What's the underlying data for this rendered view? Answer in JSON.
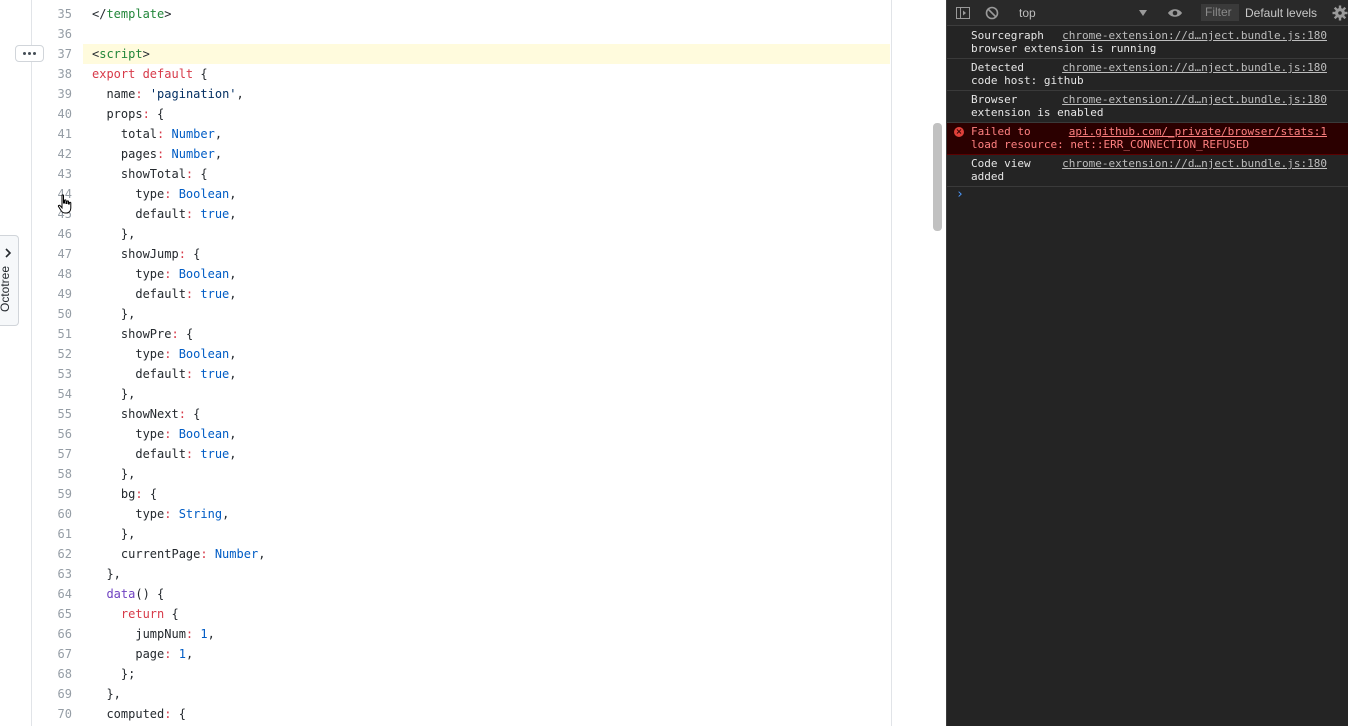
{
  "code_view": {
    "more_button_label": "…",
    "octotree_label": "Octotree",
    "lines": [
      {
        "num": "35",
        "tokens": [
          {
            "t": "</",
            "c": "t-p"
          },
          {
            "t": "template",
            "c": "t-tag"
          },
          {
            "t": ">",
            "c": "t-p"
          }
        ]
      },
      {
        "num": "36",
        "tokens": []
      },
      {
        "num": "37",
        "tokens": [
          {
            "t": "<",
            "c": "t-p"
          },
          {
            "t": "script",
            "c": "t-tag"
          },
          {
            "t": ">",
            "c": "t-p"
          }
        ]
      },
      {
        "num": "38",
        "tokens": [
          {
            "t": "export default",
            "c": "t-kw"
          },
          {
            "t": " {",
            "c": "t-p"
          }
        ]
      },
      {
        "num": "39",
        "tokens": [
          {
            "t": "  name",
            "c": "t-p"
          },
          {
            "t": ":",
            "c": "t-kw"
          },
          {
            "t": " 'pagination'",
            "c": "t-s"
          },
          {
            "t": ",",
            "c": "t-p"
          }
        ]
      },
      {
        "num": "40",
        "tokens": [
          {
            "t": "  props",
            "c": "t-p"
          },
          {
            "t": ":",
            "c": "t-kw"
          },
          {
            "t": " {",
            "c": "t-p"
          }
        ]
      },
      {
        "num": "41",
        "tokens": [
          {
            "t": "    total",
            "c": "t-p"
          },
          {
            "t": ":",
            "c": "t-kw"
          },
          {
            "t": " Number",
            "c": "t-c"
          },
          {
            "t": ",",
            "c": "t-p"
          }
        ]
      },
      {
        "num": "42",
        "tokens": [
          {
            "t": "    pages",
            "c": "t-p"
          },
          {
            "t": ":",
            "c": "t-kw"
          },
          {
            "t": " Number",
            "c": "t-c"
          },
          {
            "t": ",",
            "c": "t-p"
          }
        ]
      },
      {
        "num": "43",
        "tokens": [
          {
            "t": "    showTotal",
            "c": "t-p"
          },
          {
            "t": ":",
            "c": "t-kw"
          },
          {
            "t": " {",
            "c": "t-p"
          }
        ]
      },
      {
        "num": "44",
        "tokens": [
          {
            "t": "      type",
            "c": "t-p"
          },
          {
            "t": ":",
            "c": "t-kw"
          },
          {
            "t": " Boolean",
            "c": "t-c"
          },
          {
            "t": ",",
            "c": "t-p"
          }
        ]
      },
      {
        "num": "45",
        "tokens": [
          {
            "t": "      default",
            "c": "t-p"
          },
          {
            "t": ":",
            "c": "t-kw"
          },
          {
            "t": " true",
            "c": "t-c"
          },
          {
            "t": ",",
            "c": "t-p"
          }
        ]
      },
      {
        "num": "46",
        "tokens": [
          {
            "t": "    },",
            "c": "t-p"
          }
        ]
      },
      {
        "num": "47",
        "tokens": [
          {
            "t": "    showJump",
            "c": "t-p"
          },
          {
            "t": ":",
            "c": "t-kw"
          },
          {
            "t": " {",
            "c": "t-p"
          }
        ]
      },
      {
        "num": "48",
        "tokens": [
          {
            "t": "      type",
            "c": "t-p"
          },
          {
            "t": ":",
            "c": "t-kw"
          },
          {
            "t": " Boolean",
            "c": "t-c"
          },
          {
            "t": ",",
            "c": "t-p"
          }
        ]
      },
      {
        "num": "49",
        "tokens": [
          {
            "t": "      default",
            "c": "t-p"
          },
          {
            "t": ":",
            "c": "t-kw"
          },
          {
            "t": " true",
            "c": "t-c"
          },
          {
            "t": ",",
            "c": "t-p"
          }
        ]
      },
      {
        "num": "50",
        "tokens": [
          {
            "t": "    },",
            "c": "t-p"
          }
        ]
      },
      {
        "num": "51",
        "tokens": [
          {
            "t": "    showPre",
            "c": "t-p"
          },
          {
            "t": ":",
            "c": "t-kw"
          },
          {
            "t": " {",
            "c": "t-p"
          }
        ]
      },
      {
        "num": "52",
        "tokens": [
          {
            "t": "      type",
            "c": "t-p"
          },
          {
            "t": ":",
            "c": "t-kw"
          },
          {
            "t": " Boolean",
            "c": "t-c"
          },
          {
            "t": ",",
            "c": "t-p"
          }
        ]
      },
      {
        "num": "53",
        "tokens": [
          {
            "t": "      default",
            "c": "t-p"
          },
          {
            "t": ":",
            "c": "t-kw"
          },
          {
            "t": " true",
            "c": "t-c"
          },
          {
            "t": ",",
            "c": "t-p"
          }
        ]
      },
      {
        "num": "54",
        "tokens": [
          {
            "t": "    },",
            "c": "t-p"
          }
        ]
      },
      {
        "num": "55",
        "tokens": [
          {
            "t": "    showNext",
            "c": "t-p"
          },
          {
            "t": ":",
            "c": "t-kw"
          },
          {
            "t": " {",
            "c": "t-p"
          }
        ]
      },
      {
        "num": "56",
        "tokens": [
          {
            "t": "      type",
            "c": "t-p"
          },
          {
            "t": ":",
            "c": "t-kw"
          },
          {
            "t": " Boolean",
            "c": "t-c"
          },
          {
            "t": ",",
            "c": "t-p"
          }
        ]
      },
      {
        "num": "57",
        "tokens": [
          {
            "t": "      default",
            "c": "t-p"
          },
          {
            "t": ":",
            "c": "t-kw"
          },
          {
            "t": " true",
            "c": "t-c"
          },
          {
            "t": ",",
            "c": "t-p"
          }
        ]
      },
      {
        "num": "58",
        "tokens": [
          {
            "t": "    },",
            "c": "t-p"
          }
        ]
      },
      {
        "num": "59",
        "tokens": [
          {
            "t": "    bg",
            "c": "t-p"
          },
          {
            "t": ":",
            "c": "t-kw"
          },
          {
            "t": " {",
            "c": "t-p"
          }
        ]
      },
      {
        "num": "60",
        "tokens": [
          {
            "t": "      type",
            "c": "t-p"
          },
          {
            "t": ":",
            "c": "t-kw"
          },
          {
            "t": " String",
            "c": "t-c"
          },
          {
            "t": ",",
            "c": "t-p"
          }
        ]
      },
      {
        "num": "61",
        "tokens": [
          {
            "t": "    },",
            "c": "t-p"
          }
        ]
      },
      {
        "num": "62",
        "tokens": [
          {
            "t": "    currentPage",
            "c": "t-p"
          },
          {
            "t": ":",
            "c": "t-kw"
          },
          {
            "t": " Number",
            "c": "t-c"
          },
          {
            "t": ",",
            "c": "t-p"
          }
        ]
      },
      {
        "num": "63",
        "tokens": [
          {
            "t": "  },",
            "c": "t-p"
          }
        ]
      },
      {
        "num": "64",
        "tokens": [
          {
            "t": "  ",
            "c": "t-p"
          },
          {
            "t": "data",
            "c": "t-fn"
          },
          {
            "t": "() {",
            "c": "t-p"
          }
        ]
      },
      {
        "num": "65",
        "tokens": [
          {
            "t": "    ",
            "c": "t-p"
          },
          {
            "t": "return",
            "c": "t-kw"
          },
          {
            "t": " {",
            "c": "t-p"
          }
        ]
      },
      {
        "num": "66",
        "tokens": [
          {
            "t": "      jumpNum",
            "c": "t-p"
          },
          {
            "t": ":",
            "c": "t-kw"
          },
          {
            "t": " 1",
            "c": "t-c"
          },
          {
            "t": ",",
            "c": "t-p"
          }
        ]
      },
      {
        "num": "67",
        "tokens": [
          {
            "t": "      page",
            "c": "t-p"
          },
          {
            "t": ":",
            "c": "t-kw"
          },
          {
            "t": " 1",
            "c": "t-c"
          },
          {
            "t": ",",
            "c": "t-p"
          }
        ]
      },
      {
        "num": "68",
        "tokens": [
          {
            "t": "    };",
            "c": "t-p"
          }
        ]
      },
      {
        "num": "69",
        "tokens": [
          {
            "t": "  },",
            "c": "t-p"
          }
        ]
      },
      {
        "num": "70",
        "tokens": [
          {
            "t": "  computed",
            "c": "t-p"
          },
          {
            "t": ":",
            "c": "t-kw"
          },
          {
            "t": " {",
            "c": "t-p"
          }
        ]
      }
    ],
    "highlighted_line": "37"
  },
  "devtools": {
    "context": "top",
    "filter_placeholder": "Filter",
    "levels": "Default levels",
    "icons": [
      "sidebar-toggle-icon",
      "clear-console-icon",
      "eye-icon",
      "settings-icon"
    ],
    "messages": [
      {
        "text": "Sourcegraph\nbrowser extension is running",
        "source": "chrome-extension://d…nject.bundle.js:180",
        "error": false
      },
      {
        "text": "Detected\ncode host: github",
        "source": "chrome-extension://d…nject.bundle.js:180",
        "error": false
      },
      {
        "text": "Browser\nextension is enabled",
        "source": "chrome-extension://d…nject.bundle.js:180",
        "error": false
      },
      {
        "text": "Failed to\nload resource: net::ERR_CONNECTION_REFUSED",
        "source": "api.github.com/_private/browser/stats:1",
        "error": true
      },
      {
        "text": "Code view\nadded",
        "source": "chrome-extension://d…nject.bundle.js:180",
        "error": false
      }
    ],
    "prompt_symbol": "›"
  }
}
